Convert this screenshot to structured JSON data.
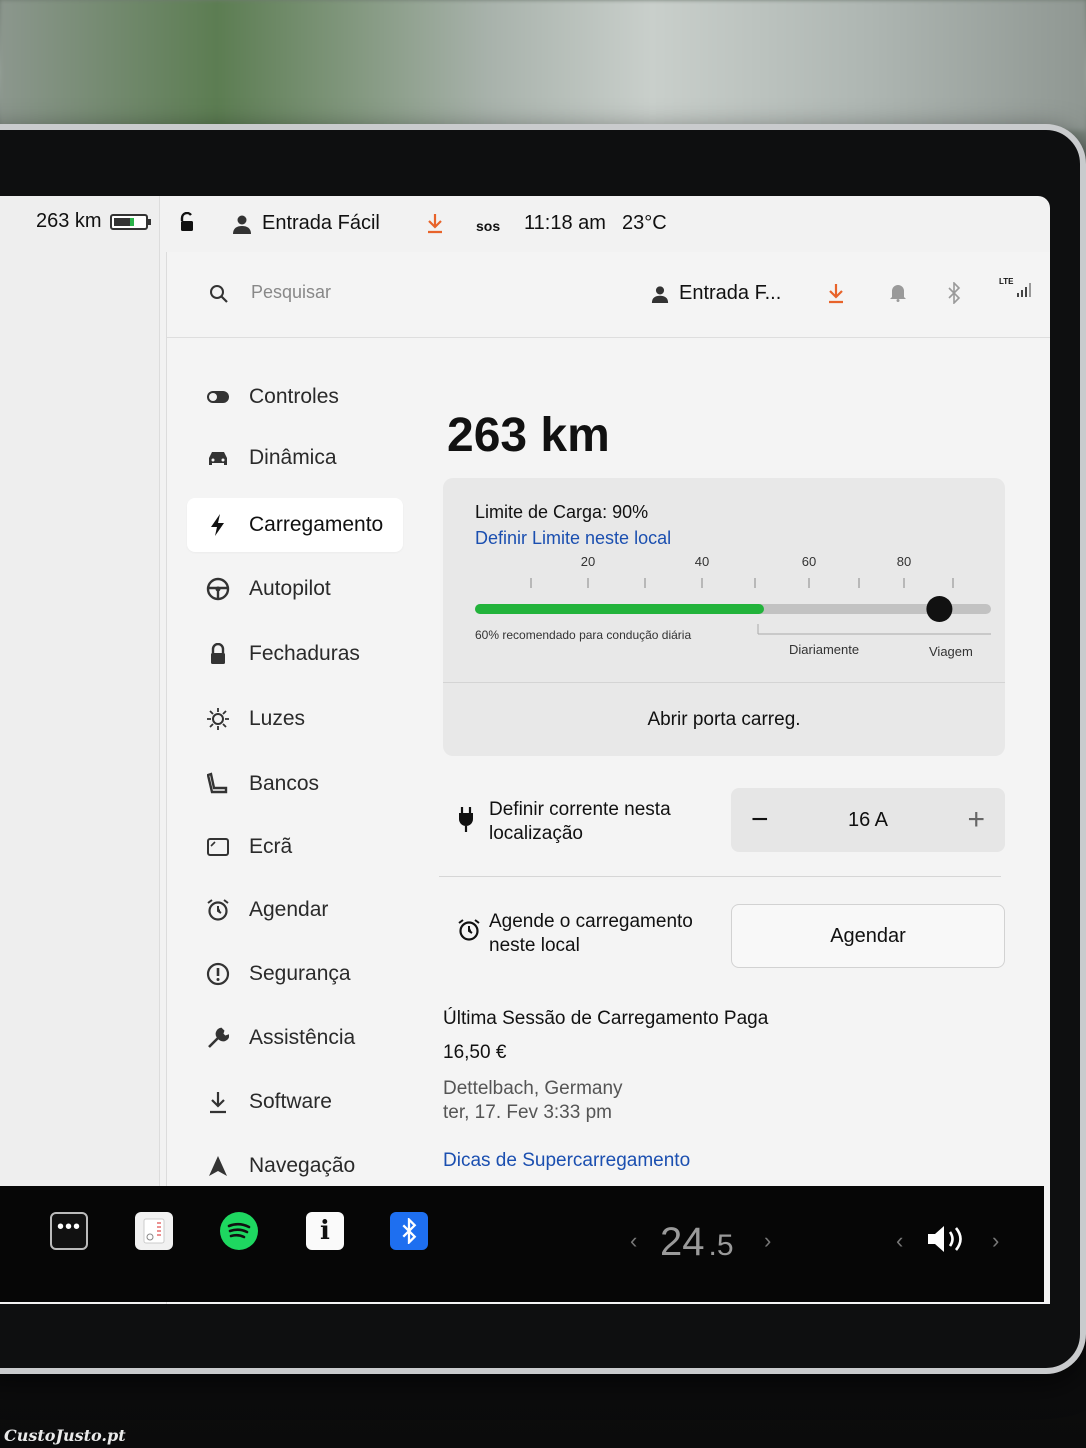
{
  "status": {
    "range_small": "263 km",
    "profile": "Entrada Fácil",
    "sos": "SOS",
    "time": "11:18 am",
    "temperature": "23°C"
  },
  "search": {
    "placeholder": "Pesquisar",
    "profile_short": "Entrada F...",
    "signal": "LTE"
  },
  "nav": {
    "items": [
      {
        "label": "Controles",
        "icon": "toggle-icon"
      },
      {
        "label": "Dinâmica",
        "icon": "car-icon"
      },
      {
        "label": "Carregamento",
        "icon": "lightning-icon"
      },
      {
        "label": "Autopilot",
        "icon": "steering-wheel-icon"
      },
      {
        "label": "Fechaduras",
        "icon": "lock-icon"
      },
      {
        "label": "Luzes",
        "icon": "light-icon"
      },
      {
        "label": "Bancos",
        "icon": "seat-icon"
      },
      {
        "label": "Ecrã",
        "icon": "display-icon"
      },
      {
        "label": "Agendar",
        "icon": "alarm-clock-icon"
      },
      {
        "label": "Segurança",
        "icon": "alert-icon"
      },
      {
        "label": "Assistência",
        "icon": "wrench-icon"
      },
      {
        "label": "Software",
        "icon": "download-icon"
      },
      {
        "label": "Navegação",
        "icon": "navigation-icon"
      }
    ],
    "active": "Carregamento"
  },
  "charging": {
    "range": "263 km",
    "limit_title": "Limite de Carga: 90%",
    "limit_link": "Definir Limite neste local",
    "limit_percent": 90,
    "current_charge_percent": 56,
    "tick_labels": [
      "20",
      "40",
      "60",
      "80"
    ],
    "recommend_text": "60% recomendado para condução diária",
    "zone_daily": "Diariamente",
    "zone_trip": "Viagem",
    "open_port": "Abrir porta carreg.",
    "current_label": "Definir corrente nesta localização",
    "current_value": "16 A",
    "schedule_label": "Agende o carregamento neste local",
    "schedule_button": "Agendar",
    "last_session_title": "Última Sessão de Carregamento Paga",
    "last_session_amount": "16,50 €",
    "last_session_place": "Dettelbach, Germany",
    "last_session_date": "ter, 17. Fev 3:33 pm",
    "tips_link": "Dicas de Supercarregamento"
  },
  "taskbar": {
    "temp_int": "24",
    "temp_dec": ".5",
    "apps": [
      "more-icon",
      "toybox-icon",
      "spotify-icon",
      "manual-icon",
      "bluetooth-icon"
    ]
  },
  "watermark": "CustoJusto.pt",
  "colors": {
    "accent_green": "#22b33b",
    "link_blue": "#1b4fb0",
    "download_orange": "#e8632a",
    "spotify_green": "#1ed760",
    "bluetooth_blue": "#1e6ff0"
  }
}
